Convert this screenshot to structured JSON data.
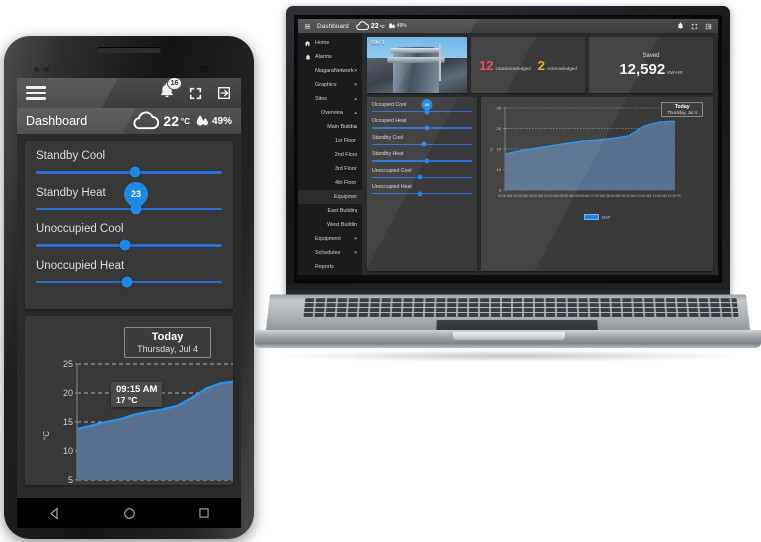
{
  "phone": {
    "topbar": {
      "menu_icon": "hamburger-icon",
      "notifications_icon": "bell-icon",
      "notifications_badge": "16",
      "fullscreen_icon": "fullscreen-icon",
      "logout_icon": "logout-icon"
    },
    "subbar": {
      "title": "Dashboard",
      "weather_icon": "cloud-icon",
      "temperature": "22",
      "degree_unit": "°C",
      "humidity_icon": "humidity-drop-icon",
      "humidity": "49%"
    },
    "sliders": [
      {
        "label": "Standby Cool",
        "value_pct": 53,
        "pin": null
      },
      {
        "label": "Standby Heat",
        "value_pct": 54,
        "pin": "23"
      },
      {
        "label": "Unoccupied Cool",
        "value_pct": 48,
        "pin": null
      },
      {
        "label": "Unoccupied Heat",
        "value_pct": 49,
        "pin": null
      }
    ],
    "chart": {
      "today_label": "Today",
      "today_date": "Thursday, Jul 4",
      "tooltip_time": "09:15 AM",
      "tooltip_value": "17 °C"
    },
    "navbar": {
      "back_icon": "back-triangle-icon",
      "home_icon": "home-circle-icon",
      "recents_icon": "recents-square-icon"
    }
  },
  "laptop": {
    "topbar": {
      "menu_icon": "hamburger-icon",
      "title": "Dashboard",
      "weather_icon": "cloud-icon",
      "temperature": "22",
      "degree_unit": "°C",
      "humidity_icon": "humidity-drop-icon",
      "humidity": "49%",
      "notifications_icon": "bell-icon",
      "fullscreen_icon": "fullscreen-icon",
      "logout_icon": "logout-icon"
    },
    "sidebar": [
      {
        "label": "Home",
        "icon": "home-icon",
        "depth": 0,
        "caret": "",
        "selected": false
      },
      {
        "label": "Alarms",
        "icon": "bell-icon",
        "depth": 0,
        "caret": "",
        "selected": false
      },
      {
        "label": "NiagaraNetwork",
        "icon": "",
        "depth": 0,
        "caret": "▾",
        "selected": false
      },
      {
        "label": "Graphics",
        "icon": "",
        "depth": 0,
        "caret": "▾",
        "selected": false
      },
      {
        "label": "Sites",
        "icon": "",
        "depth": 0,
        "caret": "▴",
        "selected": false
      },
      {
        "label": "Overview",
        "icon": "",
        "depth": 1,
        "caret": "▴",
        "selected": false
      },
      {
        "label": "Main Building",
        "icon": "",
        "depth": 2,
        "caret": "▴",
        "selected": false
      },
      {
        "label": "1st Floor",
        "icon": "",
        "depth": 3,
        "caret": "",
        "selected": false
      },
      {
        "label": "2nd Floor",
        "icon": "",
        "depth": 3,
        "caret": "",
        "selected": false
      },
      {
        "label": "3rd Floor",
        "icon": "",
        "depth": 3,
        "caret": "",
        "selected": false
      },
      {
        "label": "4th Floor",
        "icon": "",
        "depth": 3,
        "caret": "",
        "selected": false
      },
      {
        "label": "Equipment",
        "icon": "",
        "depth": 3,
        "caret": "",
        "selected": true
      },
      {
        "label": "East Building",
        "icon": "",
        "depth": 2,
        "caret": "",
        "selected": false
      },
      {
        "label": "West Building",
        "icon": "",
        "depth": 2,
        "caret": "",
        "selected": false
      },
      {
        "label": "Equipment",
        "icon": "",
        "depth": 0,
        "caret": "▾",
        "selected": false
      },
      {
        "label": "Schedules",
        "icon": "",
        "depth": 0,
        "caret": "▾",
        "selected": false
      },
      {
        "label": "Reports",
        "icon": "",
        "depth": 0,
        "caret": "",
        "selected": false
      }
    ],
    "site_card": {
      "label": "Site 1"
    },
    "alarm_card": {
      "unack_count": "12",
      "unack_label": "Unacknowledged",
      "ack_count": "2",
      "ack_label": "Acknowledged"
    },
    "saved_card": {
      "title": "Saved",
      "value": "12,592",
      "unit": "KW-HR"
    },
    "sliders": [
      {
        "label": "Occupied Cool",
        "value_pct": 55,
        "pin": "24"
      },
      {
        "label": "Occupied Heat",
        "value_pct": 55,
        "pin": null
      },
      {
        "label": "Standby Cool",
        "value_pct": 52,
        "pin": null
      },
      {
        "label": "Standby Heat",
        "value_pct": 55,
        "pin": null
      },
      {
        "label": "Unoccupied Cool",
        "value_pct": 48,
        "pin": null
      },
      {
        "label": "Unoccupied Heat",
        "value_pct": 48,
        "pin": null
      }
    ],
    "chart": {
      "today_label": "Today",
      "today_date": "Thursday, Jul 4",
      "legend": "OAT"
    }
  },
  "chart_data": [
    {
      "type": "area",
      "name": "phone-dashboard-chart",
      "title": "Today",
      "subtitle": "Thursday, Jul 4",
      "xlabel": "",
      "ylabel": "°C",
      "ylim": [
        5,
        25
      ],
      "yticks": [
        5,
        10,
        15,
        20,
        25
      ],
      "grid": true,
      "legend": "",
      "annotation": {
        "time": "09:15 AM",
        "value": "17 °C"
      },
      "x": [
        0,
        1,
        2,
        3,
        4,
        5,
        6,
        7,
        8,
        9,
        10,
        11
      ],
      "values": [
        13.8,
        14.4,
        15.0,
        15.5,
        16.3,
        16.8,
        17.2,
        17.8,
        19.2,
        20.8,
        21.7,
        22.0
      ]
    },
    {
      "type": "area",
      "name": "laptop-dashboard-chart",
      "title": "Today",
      "subtitle": "Thursday, Jul 4",
      "xlabel": "",
      "ylabel": "°C",
      "ylim": [
        5,
        25
      ],
      "yticks": [
        5,
        10,
        15,
        20,
        25
      ],
      "grid": true,
      "legend": "OAT",
      "xticks": [
        "01:00 AM",
        "02:00 AM",
        "03:00 AM",
        "04:00 AM",
        "05:00 AM",
        "06:00 AM",
        "07:00 AM",
        "08:00 AM",
        "09:00 AM",
        "10:00 AM",
        "11:00 AM",
        "12:00 PM"
      ],
      "x": [
        0,
        1,
        2,
        3,
        4,
        5,
        6,
        7,
        8,
        9,
        10,
        11
      ],
      "values": [
        13.8,
        14.6,
        15.2,
        15.8,
        16.4,
        16.9,
        17.2,
        17.6,
        18.2,
        20.6,
        21.6,
        21.8
      ]
    }
  ],
  "colors": {
    "accent": "#1e88e5",
    "track": "#2a6fd4",
    "alarm_unack": "#e8455f",
    "alarm_ack": "#e8b21e",
    "panel": "#383838",
    "app_bg": "#2b2b2b",
    "sidebar": "#1b1b1b"
  }
}
